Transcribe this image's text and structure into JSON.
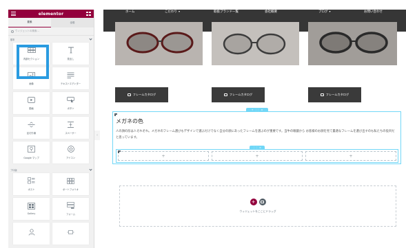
{
  "panel": {
    "logo": "elementor",
    "tabs": [
      "要素",
      "全般"
    ],
    "search_placeholder": "ウィジェットの検索…",
    "categories": [
      {
        "title": "基本",
        "widgets": [
          {
            "label": "内部セクション",
            "icon": "inner-section-icon"
          },
          {
            "label": "見出し",
            "icon": "heading-icon"
          },
          {
            "label": "画像",
            "icon": "image-icon"
          },
          {
            "label": "テキストエディター",
            "icon": "text-editor-icon"
          },
          {
            "label": "動画",
            "icon": "video-icon"
          },
          {
            "label": "ボタン",
            "icon": "button-icon"
          },
          {
            "label": "区切り線",
            "icon": "divider-icon"
          },
          {
            "label": "スペーサー",
            "icon": "spacer-icon"
          },
          {
            "label": "Google マップ",
            "icon": "map-icon"
          },
          {
            "label": "アイコン",
            "icon": "star-icon"
          }
        ]
      },
      {
        "title": "プロ版",
        "widgets": [
          {
            "label": "ポスト",
            "icon": "posts-icon"
          },
          {
            "label": "ポートフォリオ",
            "icon": "portfolio-icon"
          },
          {
            "label": "Gallery",
            "icon": "gallery-icon"
          },
          {
            "label": "フォーム",
            "icon": "form-icon"
          },
          {
            "label": "",
            "icon": "login-icon"
          },
          {
            "label": "",
            "icon": "slides-icon"
          }
        ]
      }
    ]
  },
  "nav": {
    "items": [
      {
        "label": "ホーム",
        "caret": false
      },
      {
        "label": "こだわり",
        "caret": true
      },
      {
        "label": "取扱ブランド一覧",
        "caret": false
      },
      {
        "label": "会社概要",
        "caret": false
      },
      {
        "label": "ブログ",
        "caret": true
      },
      {
        "label": "お問い合わせ",
        "caret": false
      }
    ]
  },
  "gallery": {
    "button_label": "フレームカタログ"
  },
  "content": {
    "heading": "メガネの色",
    "paragraph": "人の顔の形は人それぞれ。メガネのフレーム選びもデザインで選ぶだけでなく自分の顔にあったフレームを選ぶのが重要です。当牛の眼鏡から お客様のお顔を見て最適なフレームを選び出すのも私たちの役目だと思っています。"
  },
  "add_section": {
    "drop_text": "ウィジェットをここにドラッグ"
  },
  "colors": {
    "brand": "#93003c",
    "nav_bg": "#363636",
    "selection": "#71d7f7",
    "highlight": "#2a9be0"
  }
}
